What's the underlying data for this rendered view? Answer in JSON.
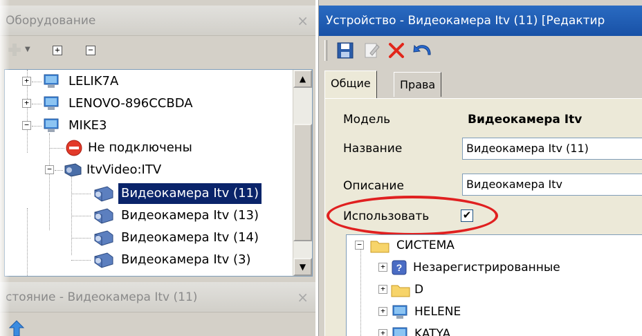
{
  "equipment_panel": {
    "title": "Оборудование",
    "close": "×"
  },
  "tree": {
    "nodes": [
      {
        "label": "LELIK7A",
        "expander": "+"
      },
      {
        "label": "LENOVO-896CCBDA",
        "expander": "+"
      },
      {
        "label": "MIKE3",
        "expander": "−"
      },
      {
        "label": "Не подключены"
      },
      {
        "label": "ItvVideo:ITV",
        "expander": "−"
      },
      {
        "label": "Видеокамера Itv (11)",
        "selected": true
      },
      {
        "label": "Видеокамера Itv (13)"
      },
      {
        "label": "Видеокамера Itv (14)"
      },
      {
        "label": "Видеокамера Itv (3)"
      }
    ]
  },
  "state_panel": {
    "title": "стояние - Видеокамера Itv (11)",
    "close": "×"
  },
  "device_window": {
    "title": "Устройство - Видеокамера Itv (11) [Редактир"
  },
  "toolbar": {
    "icons": [
      "save-icon",
      "edit-icon",
      "delete-icon",
      "undo-icon"
    ]
  },
  "tabs": [
    {
      "label": "Общие",
      "active": true
    },
    {
      "label": "Права",
      "active": false
    }
  ],
  "form": {
    "model_label": "Модель",
    "model_value": "Видеокамера Itv",
    "name_label": "Название",
    "name_value": "Видеокамера Itv (11)",
    "desc_label": "Описание",
    "desc_value": "Видеокамера Itv",
    "use_label": "Использовать",
    "use_checked": true,
    "use_check_glyph": "✔"
  },
  "group_tree": {
    "nodes": [
      {
        "label": "СИСТЕМА",
        "expander": "−"
      },
      {
        "label": "Незарегистрированные",
        "expander": "+"
      },
      {
        "label": "D",
        "expander": "+"
      },
      {
        "label": "HELENE",
        "expander": "+"
      },
      {
        "label": "KATYA",
        "expander": "+"
      }
    ]
  },
  "colors": {
    "selection": "#0a246a",
    "title_active": "#1851a6",
    "highlight": "#e02020"
  }
}
